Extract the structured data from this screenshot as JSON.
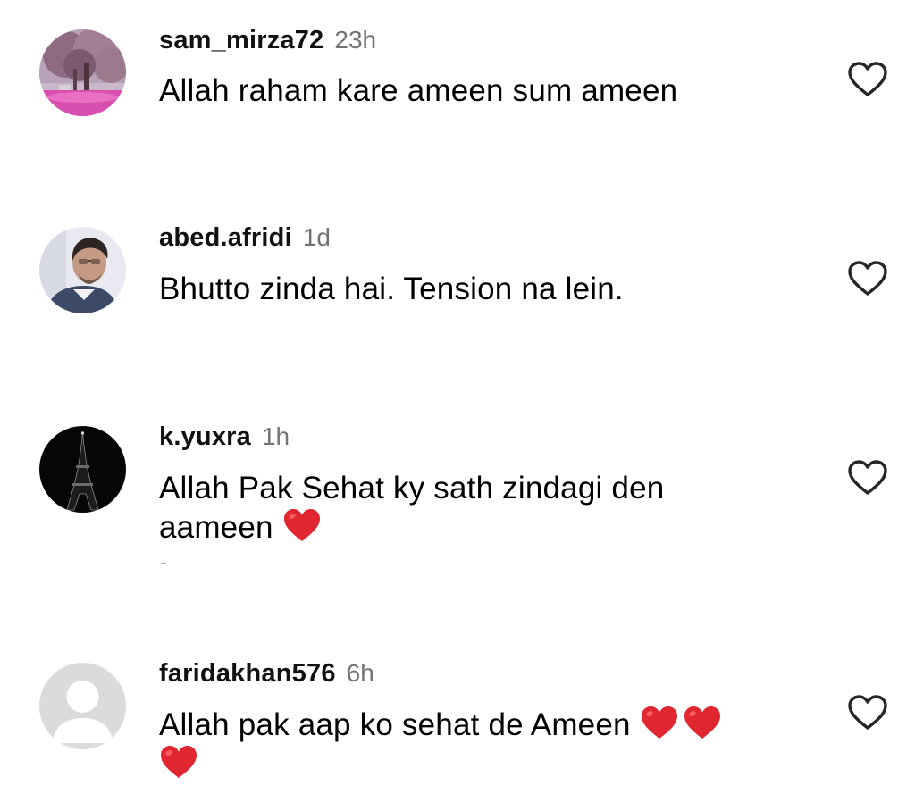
{
  "colors": {
    "text": "#000000",
    "username": "#111111",
    "timestamp": "#737373",
    "heart_emoji": "#e0262e",
    "like_outline": "#262626"
  },
  "comments": [
    {
      "username": "sam_mirza72",
      "time": "23h",
      "text": "Allah raham kare ameen sum ameen",
      "avatar": "park-tree-photo",
      "like_icon": "heart-outline-icon"
    },
    {
      "username": "abed.afridi",
      "time": "1d",
      "text": "Bhutto zinda hai. Tension na lein.",
      "avatar": "man-with-sunglasses-photo",
      "like_icon": "heart-outline-icon"
    },
    {
      "username": "k.yuxra",
      "time": "1h",
      "text_line1": "Allah Pak Sehat ky sath zindagi den",
      "text_line2": "aameen",
      "emoji": "red-heart-emoji",
      "avatar": "eiffel-tower-night-photo",
      "like_icon": "heart-outline-icon"
    },
    {
      "username": "faridakhan576",
      "time": "6h",
      "text_line1": "Allah pak aap ko sehat de Ameen",
      "emoji": "red-heart-emoji",
      "emoji_count": 3,
      "avatar": "default-profile-placeholder",
      "like_icon": "heart-outline-icon"
    }
  ]
}
